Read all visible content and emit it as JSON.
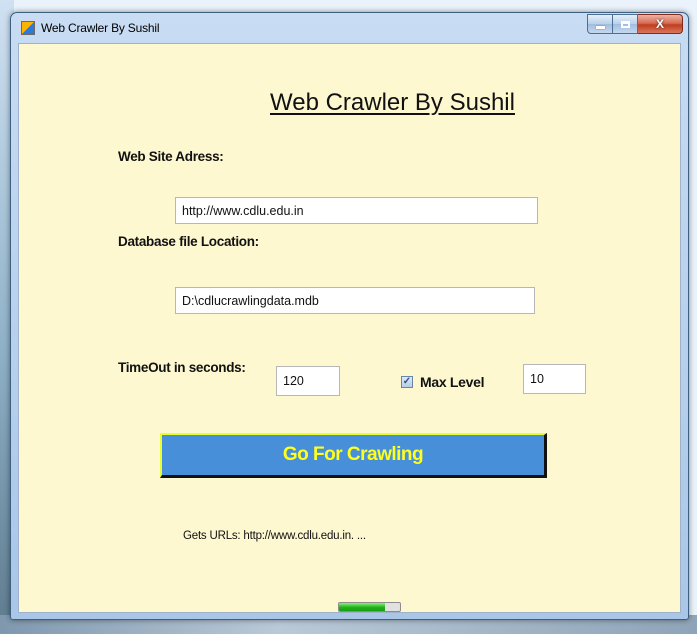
{
  "window": {
    "title": "Web Crawler By Sushil",
    "icon": "app-icon",
    "controls": [
      "minimize-icon",
      "maximize-icon",
      "close-icon"
    ],
    "close_glyph": "X"
  },
  "form": {
    "heading": "Web Crawler By Sushil",
    "website_label": "Web Site Adress:",
    "website_value": "http://www.cdlu.edu.in",
    "db_label": "Database file Location:",
    "db_value": "D:\\cdlucrawlingdata.mdb",
    "timeout_label": "TimeOut in seconds:",
    "timeout_value": "120",
    "maxlevel_checked": true,
    "maxlevel_check_glyph": "✓",
    "maxlevel_label": "Max Level",
    "maxlevel_value": "10",
    "go_button": "Go For Crawling",
    "status_text": "Gets URLs: http://www.cdlu.edu.in. ...",
    "progress": 0.75
  },
  "colors": {
    "client_background": "#fdf8cf",
    "button_fill": "#4790d9",
    "button_text": "#ffff1f",
    "progress_fill": "#1fb21a"
  }
}
